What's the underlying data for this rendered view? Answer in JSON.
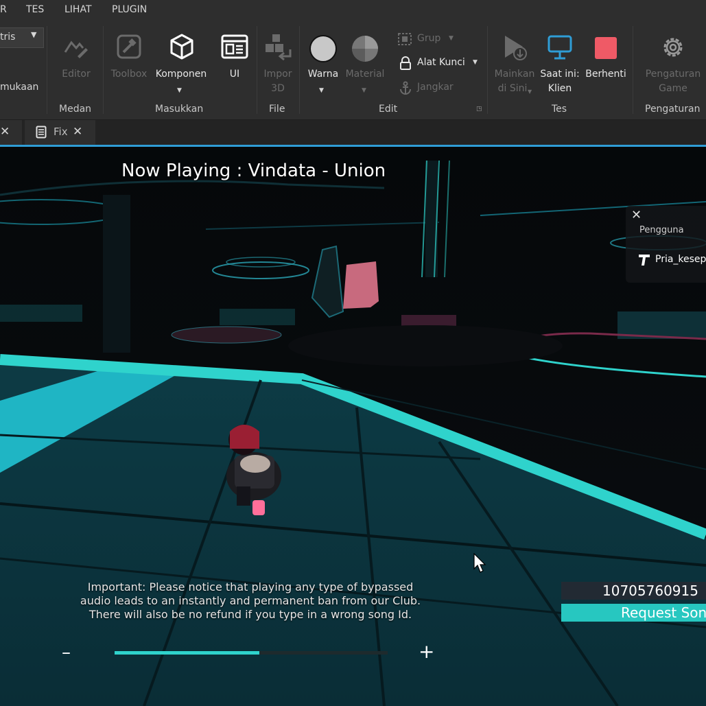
{
  "menubar": {
    "items": [
      "R",
      "TES",
      "LIHAT",
      "PLUGIN"
    ]
  },
  "ribbon": {
    "partial_dropdown": "tris",
    "partial_label": "mukaan",
    "groups": [
      "Medan",
      "Masukkan",
      "File",
      "Edit",
      "Tes",
      "Pengaturan"
    ],
    "tools": {
      "editor": "Editor",
      "toolbox": "Toolbox",
      "komponen": "Komponen",
      "ui": "UI",
      "impor3d": [
        "Impor",
        "3D"
      ],
      "warna": "Warna",
      "material": "Material",
      "grup": "Grup",
      "alat_kunci": "Alat Kunci",
      "jangkar": "Jangkar",
      "mainkan": [
        "Mainkan",
        "di Sini"
      ],
      "saat_ini": [
        "Saat ini:",
        "Klien"
      ],
      "berhenti": "Berhenti",
      "pengaturan_game": [
        "Pengaturan",
        "Game"
      ]
    }
  },
  "tabs": [
    {
      "label": ""
    },
    {
      "label": "Fix"
    }
  ],
  "game": {
    "now_playing": "Now Playing : Vindata - Union",
    "users_panel": {
      "title": "Pengguna",
      "user": "Pria_kesep"
    },
    "notice": [
      "Important: Please notice that playing any type of bypassed",
      "audio leads to an instantly and permanent ban from our Club.",
      "There will also be no refund if you type in a wrong song Id."
    ],
    "volume_minus": "–",
    "volume_plus": "+",
    "volume_level": 0.53,
    "song_id": "10705760915",
    "request_label": "Request Song"
  },
  "colors": {
    "accent_cyan": "#2fd3cc",
    "stop_red": "#ef5a66",
    "studio_blue": "#2f9dd6"
  }
}
